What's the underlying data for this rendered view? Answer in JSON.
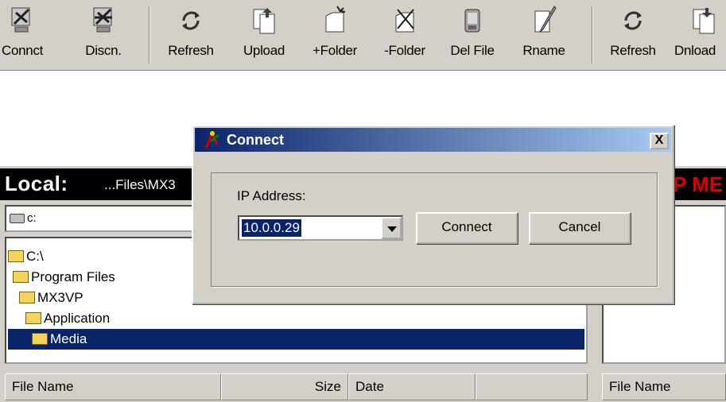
{
  "toolbar": {
    "items": [
      {
        "label": "Connct",
        "icon": "connect-icon"
      },
      {
        "label": "Discn.",
        "icon": "disconnect-icon"
      },
      {
        "label": "Refresh",
        "icon": "refresh-icon"
      },
      {
        "label": "Upload",
        "icon": "upload-icon"
      },
      {
        "label": "+Folder",
        "icon": "new-folder-icon"
      },
      {
        "label": "-Folder",
        "icon": "delete-folder-icon"
      },
      {
        "label": "Del File",
        "icon": "delete-file-icon"
      },
      {
        "label": "Rname",
        "icon": "rename-icon"
      },
      {
        "label": "Refresh",
        "icon": "refresh-icon"
      },
      {
        "label": "Dnload",
        "icon": "download-icon"
      }
    ]
  },
  "local": {
    "title": "Local:",
    "path": "...Files\\MX3",
    "drive": "c:",
    "tree": [
      "C:\\",
      "Program Files",
      "MX3VP",
      "Application",
      "Media"
    ],
    "selected": "Media",
    "columns": [
      "File Name",
      "Size",
      "Date"
    ]
  },
  "remote": {
    "title": "P ME",
    "columns": [
      "File Name"
    ]
  },
  "dialog": {
    "title": "Connect",
    "close_label": "X",
    "ip_label": "IP Address:",
    "ip_value": "10.0.0.29",
    "connect_label": "Connect",
    "cancel_label": "Cancel"
  },
  "colors": {
    "face": "#d4d0c8",
    "selection": "#0a246a",
    "remote_title": "#e00000",
    "title_gradient_end": "#a6caf0"
  }
}
